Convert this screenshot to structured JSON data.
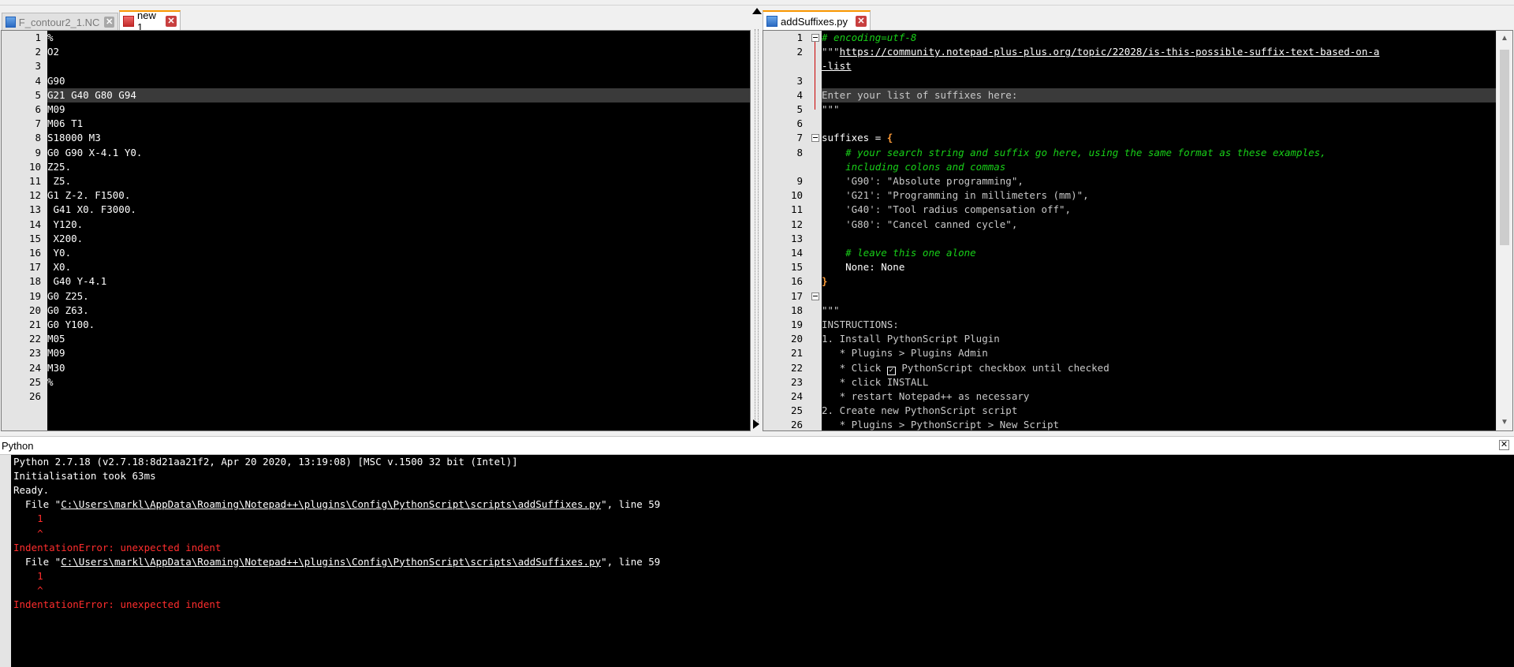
{
  "left_pane": {
    "tabs": [
      {
        "label": "F_contour2_1.NC",
        "active": false
      },
      {
        "label": "new 1",
        "active": true
      }
    ],
    "current_line": 5,
    "lines": [
      "%",
      "O2",
      "",
      "G90",
      "G21 G40 G80 G94",
      "M09",
      "M06 T1",
      "S18000 M3",
      "G0 G90 X-4.1 Y0.",
      "Z25.",
      " Z5.",
      "G1 Z-2. F1500.",
      " G41 X0. F3000.",
      " Y120.",
      " X200.",
      " Y0.",
      " X0.",
      " G40 Y-4.1",
      "G0 Z25.",
      "G0 Z63.",
      "G0 Y100.",
      "M05",
      "M09",
      "M30",
      "%",
      ""
    ]
  },
  "right_pane": {
    "tabs": [
      {
        "label": "addSuffixes.py",
        "active": true
      }
    ],
    "current_line": 4,
    "rows": [
      {
        "n": "1",
        "parts": [
          {
            "t": "# encoding=utf-8",
            "c": "comment"
          }
        ]
      },
      {
        "n": "2",
        "parts": [
          {
            "t": "\"\"\"",
            "c": "str"
          },
          {
            "t": "https://community.notepad-plus-plus.org/topic/22028/is-this-possible-suffix-text-based-on-a",
            "c": "url"
          }
        ]
      },
      {
        "n": "",
        "parts": [
          {
            "t": "-list",
            "c": "url"
          }
        ]
      },
      {
        "n": "3",
        "parts": []
      },
      {
        "n": "4",
        "parts": [
          {
            "t": "Enter your list of suffixes here:",
            "c": "str"
          }
        ]
      },
      {
        "n": "5",
        "parts": [
          {
            "t": "\"\"\"",
            "c": "str"
          }
        ]
      },
      {
        "n": "6",
        "parts": []
      },
      {
        "n": "7",
        "parts": [
          {
            "t": "suffixes = ",
            "c": "kw"
          },
          {
            "t": "{",
            "c": "brace"
          }
        ]
      },
      {
        "n": "8",
        "parts": [
          {
            "t": "    # your search string and suffix go here, using the same format as these examples,",
            "c": "comment"
          }
        ]
      },
      {
        "n": "",
        "parts": [
          {
            "t": "    including colons and commas",
            "c": "comment"
          }
        ]
      },
      {
        "n": "9",
        "parts": [
          {
            "t": "    'G90': \"Absolute programming\",",
            "c": "str"
          }
        ]
      },
      {
        "n": "10",
        "parts": [
          {
            "t": "    'G21': \"Programming in millimeters (mm)\",",
            "c": "str"
          }
        ]
      },
      {
        "n": "11",
        "parts": [
          {
            "t": "    'G40': \"Tool radius compensation off\",",
            "c": "str"
          }
        ]
      },
      {
        "n": "12",
        "parts": [
          {
            "t": "    'G80': \"Cancel canned cycle\",",
            "c": "str"
          }
        ]
      },
      {
        "n": "13",
        "parts": []
      },
      {
        "n": "14",
        "parts": [
          {
            "t": "    # leave this one alone",
            "c": "comment"
          }
        ]
      },
      {
        "n": "15",
        "parts": [
          {
            "t": "    None: None",
            "c": "kw"
          }
        ]
      },
      {
        "n": "16",
        "parts": [
          {
            "t": "}",
            "c": "brace"
          }
        ]
      },
      {
        "n": "17",
        "parts": []
      },
      {
        "n": "18",
        "parts": [
          {
            "t": "\"\"\"",
            "c": "str"
          }
        ]
      },
      {
        "n": "19",
        "parts": [
          {
            "t": "INSTRUCTIONS:",
            "c": "str"
          }
        ]
      },
      {
        "n": "20",
        "parts": [
          {
            "t": "1. Install PythonScript Plugin",
            "c": "str"
          }
        ]
      },
      {
        "n": "21",
        "parts": [
          {
            "t": "   * Plugins > Plugins Admin",
            "c": "str"
          }
        ]
      },
      {
        "n": "22",
        "parts": [
          {
            "t": "   * Click ",
            "c": "str"
          },
          {
            "t": "✓",
            "c": "check"
          },
          {
            "t": " PythonScript checkbox until checked",
            "c": "str"
          }
        ]
      },
      {
        "n": "23",
        "parts": [
          {
            "t": "   * click INSTALL",
            "c": "str"
          }
        ]
      },
      {
        "n": "24",
        "parts": [
          {
            "t": "   * restart Notepad++ as necessary",
            "c": "str"
          }
        ]
      },
      {
        "n": "25",
        "parts": [
          {
            "t": "2. Create new PythonScript script",
            "c": "str"
          }
        ]
      },
      {
        "n": "26",
        "parts": [
          {
            "t": "   * Plugins > PythonScript > New Script",
            "c": "str"
          }
        ]
      }
    ]
  },
  "console": {
    "title": "Python",
    "close_glyph": "✕",
    "lines": [
      {
        "parts": [
          {
            "t": "Python 2.7.18 (v2.7.18:8d21aa21f2, Apr 20 2020, 13:19:08) [MSC v.1500 32 bit (Intel)]"
          }
        ]
      },
      {
        "parts": [
          {
            "t": "Initialisation took 63ms"
          }
        ]
      },
      {
        "parts": [
          {
            "t": "Ready."
          }
        ]
      },
      {
        "parts": [
          {
            "t": "  File \""
          },
          {
            "t": "C:\\Users\\markl\\AppData\\Roaming\\Notepad++\\plugins\\Config\\PythonScript\\scripts\\addSuffixes.py",
            "u": true
          },
          {
            "t": "\", line 59"
          }
        ]
      },
      {
        "parts": [
          {
            "t": "    1",
            "red": true
          }
        ]
      },
      {
        "parts": [
          {
            "t": "    ^",
            "red": true
          }
        ]
      },
      {
        "parts": [
          {
            "t": "IndentationError: unexpected indent",
            "red": true
          }
        ]
      },
      {
        "parts": [
          {
            "t": "  File \""
          },
          {
            "t": "C:\\Users\\markl\\AppData\\Roaming\\Notepad++\\plugins\\Config\\PythonScript\\scripts\\addSuffixes.py",
            "u": true
          },
          {
            "t": "\", line 59"
          }
        ]
      },
      {
        "parts": [
          {
            "t": "    1",
            "red": true
          }
        ]
      },
      {
        "parts": [
          {
            "t": "    ^",
            "red": true
          }
        ]
      },
      {
        "parts": [
          {
            "t": "IndentationError: unexpected indent",
            "red": true
          }
        ]
      }
    ]
  },
  "colors": {
    "editor_bg": "#000000",
    "current_line_bg": "#3a3a3a",
    "comment": "#18d018",
    "error": "#ff2d2d",
    "brace": "#ff9d3a",
    "tab_accent": "#f99600"
  }
}
